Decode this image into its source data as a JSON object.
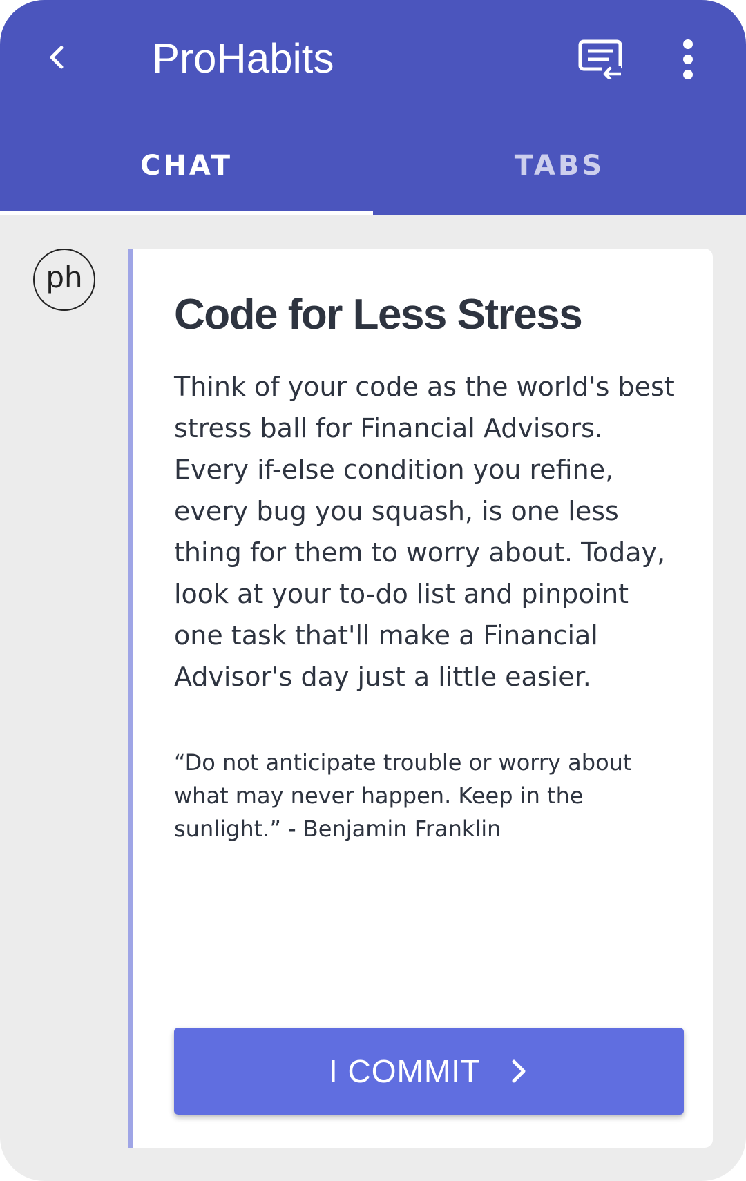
{
  "colors": {
    "app_bar": "#4b55bd",
    "background": "#ececec",
    "card": "#ffffff",
    "card_accent": "#9fa5e6",
    "button": "#606ee0",
    "text": "#2e3440"
  },
  "app_bar": {
    "title": "ProHabits",
    "back_icon": "chevron-left-icon",
    "action_icon": "chat-swap-icon",
    "menu_icon": "more-vertical-icon"
  },
  "tabs": [
    {
      "label": "CHAT",
      "selected": true
    },
    {
      "label": "TABS",
      "selected": false
    }
  ],
  "message": {
    "avatar_text": "ph",
    "title": "Code for Less Stress",
    "body": "Think of your code as the world's best stress ball for Financial Advisors. Every if-else condition you refine, every bug you squash, is one less thing for them to worry about. Today, look at your to-do list and pinpoint one task that'll make a Financial Advisor's day just a little easier.",
    "quote": "“Do not anticipate trouble or worry about what may never happen. Keep in the sunlight.” - Benjamin Franklin",
    "button_label": "I COMMIT",
    "button_icon": "chevron-right-icon"
  }
}
